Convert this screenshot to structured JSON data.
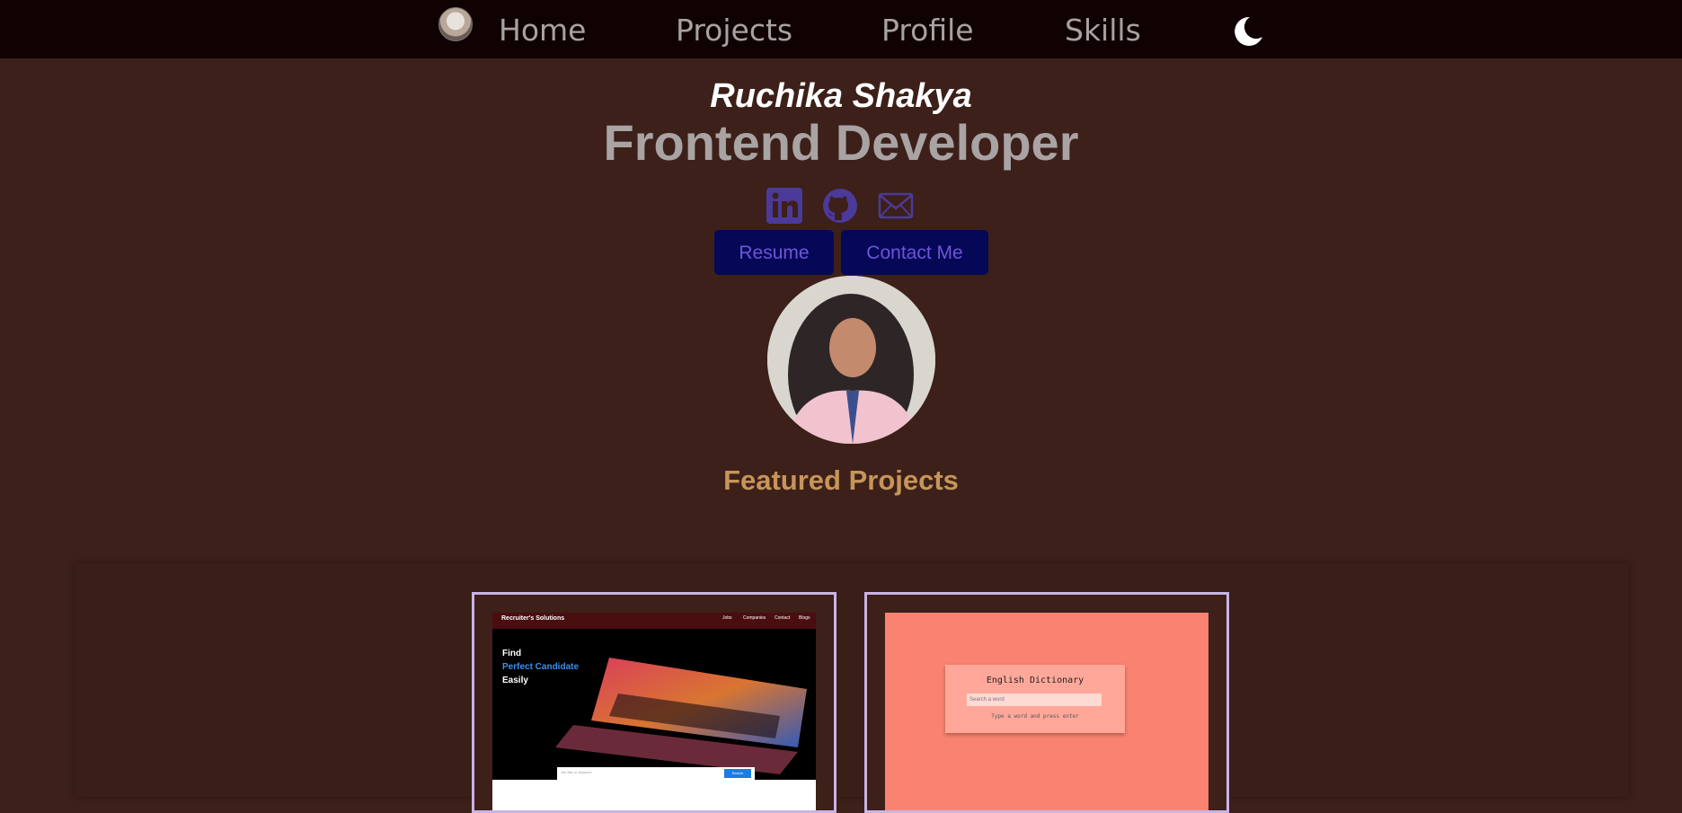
{
  "nav": {
    "links": [
      {
        "label": "Home"
      },
      {
        "label": "Projects"
      },
      {
        "label": "Profile"
      },
      {
        "label": "Skills"
      }
    ],
    "logo_icon": "profile-logo-icon",
    "theme_icon": "moon-icon"
  },
  "hero": {
    "name": "Ruchika Shakya",
    "role": "Frontend Developer",
    "social_icons": [
      "linkedin-icon",
      "github-icon",
      "mail-icon"
    ],
    "buttons": {
      "resume": "Resume",
      "contact": "Contact Me"
    }
  },
  "featured": {
    "title": "Featured Projects",
    "projects": [
      {
        "brand": "Recruiter's Solutions",
        "menu": [
          "Jobs",
          "Companies",
          "Contact",
          "Blogs"
        ],
        "hero_lines": [
          "Find",
          "Perfect Candidate",
          "Easily"
        ],
        "search_placeholder": "Job title or keyword",
        "search_button": "Search"
      },
      {
        "title": "English Dictionary",
        "input_placeholder": "Search a word",
        "hint": "Type a word and press enter"
      }
    ]
  },
  "colors": {
    "background": "#3c2019",
    "nav_background": "#100202",
    "button_background": "#050856",
    "button_text": "#6f54d8",
    "accent_title": "#c7955a",
    "card_border": "#c9b4e6",
    "social_icon": "#4b3a9a"
  }
}
